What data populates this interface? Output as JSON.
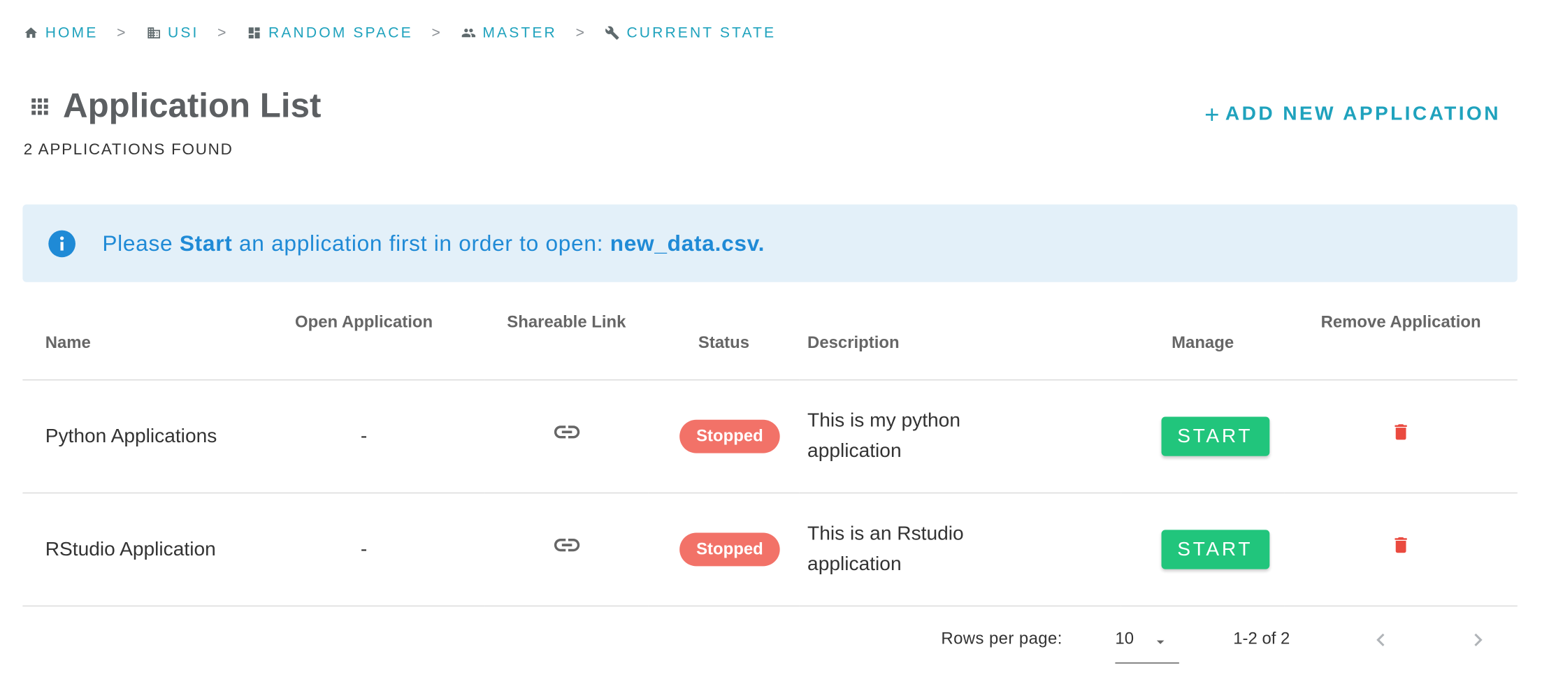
{
  "breadcrumb": {
    "items": [
      {
        "label": "Home",
        "icon": "home-icon"
      },
      {
        "label": "USI",
        "icon": "building-icon"
      },
      {
        "label": "Random Space",
        "icon": "dashboard-icon"
      },
      {
        "label": "Master",
        "icon": "people-icon"
      },
      {
        "label": "Current State",
        "icon": "wrench-icon"
      }
    ],
    "separator": ">"
  },
  "header": {
    "title": "Application List",
    "title_icon": "apps-grid-icon",
    "subtitle": "2 APPLICATIONS FOUND",
    "add_button": {
      "plus": "+",
      "label": "ADD NEW APPLICATION"
    }
  },
  "alert": {
    "icon": "info-icon",
    "prefix": "Please ",
    "action": "Start",
    "middle": " an application first in order to open: ",
    "file": "new_data.csv."
  },
  "table": {
    "columns": [
      "Name",
      "Open Application",
      "Shareable Link",
      "Status",
      "Description",
      "Manage",
      "Remove Application"
    ],
    "rows": [
      {
        "name": "Python Applications",
        "open": "-",
        "status": "Stopped",
        "description": "This is my python application",
        "manage": "START"
      },
      {
        "name": "RStudio Application",
        "open": "-",
        "status": "Stopped",
        "description": "This is an Rstudio application",
        "manage": "START"
      }
    ]
  },
  "pagination": {
    "rows_label": "Rows per page:",
    "rows_value": "10",
    "range": "1-2 of 2"
  },
  "colors": {
    "accent": "#1fa2bd",
    "info": "#1f8ad6",
    "alert_bg": "#e3f0f9",
    "stopped": "#f27268",
    "start": "#21c57c",
    "delete": "#ea4a3f"
  }
}
